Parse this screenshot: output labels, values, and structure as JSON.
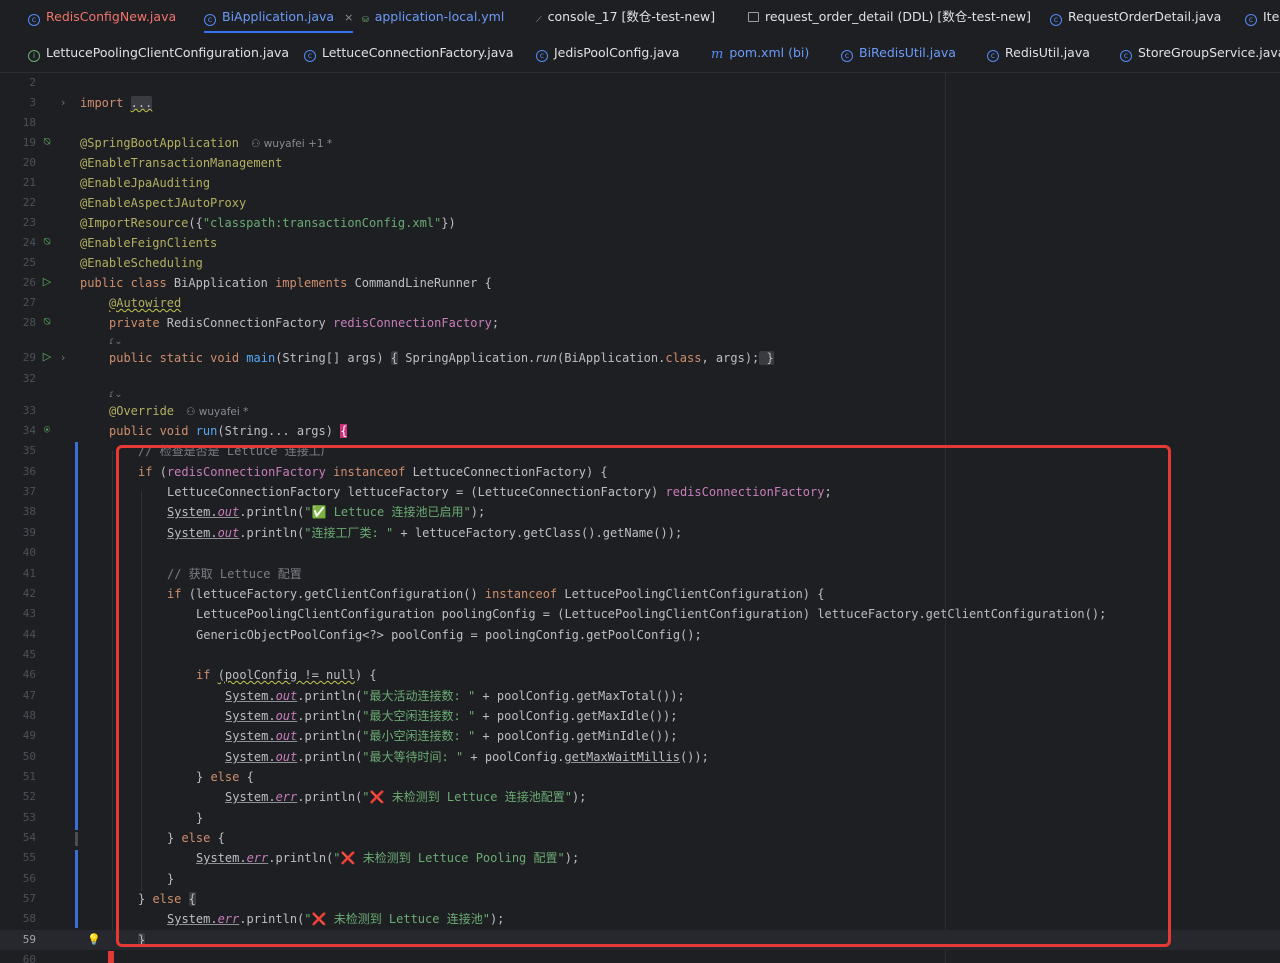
{
  "tabs_row1": [
    {
      "label": "RedisConfigNew.java",
      "icon": "class-icon",
      "style": "red"
    },
    {
      "label": "BiApplication.java",
      "icon": "class-icon",
      "style": "blue",
      "active": true,
      "close": "×"
    },
    {
      "label": "application-local.yml",
      "icon": "yml-icon",
      "style": "blue"
    },
    {
      "label": "console_17 [数仓-test-new]",
      "icon": "console-icon",
      "style": "normal"
    },
    {
      "label": "request_order_detail (DDL) [数仓-test-new]",
      "icon": "table-icon",
      "style": "normal"
    },
    {
      "label": "RequestOrderDetail.java",
      "icon": "class-icon",
      "style": "normal"
    },
    {
      "label": "Iter",
      "icon": "class-icon",
      "style": "normal"
    }
  ],
  "tabs_row2": [
    {
      "label": "LettucePoolingClientConfiguration.java",
      "icon": "interface-icon",
      "style": "normal"
    },
    {
      "label": "LettuceConnectionFactory.java",
      "icon": "class-icon",
      "style": "normal"
    },
    {
      "label": "JedisPoolConfig.java",
      "icon": "class-icon",
      "style": "normal"
    },
    {
      "label": "pom.xml (bi)",
      "icon": "maven-icon",
      "style": "blue"
    },
    {
      "label": "BiRedisUtil.java",
      "icon": "class-icon",
      "style": "blue"
    },
    {
      "label": "RedisUtil.java",
      "icon": "class-icon",
      "style": "normal"
    },
    {
      "label": "StoreGroupService.java",
      "icon": "class-icon",
      "style": "normal"
    }
  ],
  "editor": {
    "line_numbers": [
      "2",
      "3",
      "18",
      "19",
      "20",
      "21",
      "22",
      "23",
      "24",
      "25",
      "26",
      "27",
      "28",
      "29",
      "32",
      "33",
      "34",
      "35",
      "36",
      "37",
      "38",
      "39",
      "40",
      "41",
      "42",
      "43",
      "44",
      "45",
      "46",
      "47",
      "48",
      "49",
      "50",
      "51",
      "52",
      "53",
      "54",
      "55",
      "56",
      "57",
      "58",
      "59",
      "60"
    ],
    "authors": {
      "line19": "wuyafei +1 *",
      "line33": "wuyafei *"
    },
    "code": {
      "l3_kw": "import",
      "l3_rest": "...",
      "l19": "@SpringBootApplication",
      "l20": "@EnableTransactionManagement",
      "l21": "@EnableJpaAuditing",
      "l22": "@EnableAspectJAutoProxy",
      "l23_a": "@ImportResource",
      "l23_b": "({",
      "l23_c": "\"classpath:transactionConfig.xml\"",
      "l23_d": "})",
      "l24": "@EnableFeignClients",
      "l25": "@EnableScheduling",
      "l26_a": "public class ",
      "l26_b": "BiApplication ",
      "l26_c": "implements ",
      "l26_d": "CommandLineRunner {",
      "l27": "@Autowired",
      "l28_a": "private ",
      "l28_b": "RedisConnectionFactory ",
      "l28_c": "redisConnectionFactory",
      "l28_d": ";",
      "l29_a": "public static void ",
      "l29_b": "main",
      "l29_c": "(String[] args) ",
      "l29_d": "{",
      "l29_e": " SpringApplication.",
      "l29_f": "run",
      "l29_g": "(BiApplication.",
      "l29_h": "class",
      "l29_i": ", args);",
      "l29_j": " }",
      "l33": "@Override",
      "l34_a": "public void ",
      "l34_b": "run",
      "l34_c": "(String... args) ",
      "l34_d": "{",
      "l35": "// 检查是否是 Lettuce 连接工厂",
      "l36_a": "if ",
      "l36_b": "(",
      "l36_c": "redisConnectionFactory ",
      "l36_d": "instanceof ",
      "l36_e": "LettuceConnectionFactory) {",
      "l37_a": "LettuceConnectionFactory lettuceFactory = (LettuceConnectionFactory) ",
      "l37_b": "redisConnectionFactory",
      "l37_c": ";",
      "l38_a": "System.",
      "l38_b": "out",
      "l38_c": ".println(",
      "l38_d": "\"✅ Lettuce 连接池已启用\"",
      "l38_e": ");",
      "l39_a": "System.",
      "l39_b": "out",
      "l39_c": ".println(",
      "l39_d": "\"连接工厂类: \"",
      "l39_e": " + lettuceFactory.getClass().getName());",
      "l41": "// 获取 Lettuce 配置",
      "l42_a": "if ",
      "l42_b": "(lettuceFactory.getClientConfiguration() ",
      "l42_c": "instanceof ",
      "l42_d": "LettucePoolingClientConfiguration) {",
      "l43": "LettucePoolingClientConfiguration poolingConfig = (LettucePoolingClientConfiguration) lettuceFactory.getClientConfiguration();",
      "l44": "GenericObjectPoolConfig<?> poolConfig = poolingConfig.getPoolConfig();",
      "l46_a": "if ",
      "l46_b": "(poolConfig != null",
      "l46_c": ") {",
      "l47_d": "\"最大活动连接数: \"",
      "l47_e": " + poolConfig.getMaxTotal());",
      "l48_d": "\"最大空闲连接数: \"",
      "l48_e": " + poolConfig.getMaxIdle());",
      "l49_d": "\"最小空闲连接数: \"",
      "l49_e": " + poolConfig.getMinIdle());",
      "l50_d": "\"最大等待时间: \"",
      "l50_e1": " + poolConfig.",
      "l50_e2": "getMaxWaitMillis",
      "l50_e3": "());",
      "l51_a": "} ",
      "l51_b": "else ",
      "l51_c": "{",
      "l52_a": "System.",
      "l52_b": "err",
      "l52_c": ".println(",
      "l52_d": "\"❌ 未检测到 Lettuce 连接池配置\"",
      "l52_e": ");",
      "close": "}",
      "l55_d": "\"❌ 未检测到 Lettuce Pooling 配置\"",
      "l58_d": "\"❌ 未检测到 Lettuce 连接池\"",
      "l59": "}"
    },
    "inlay_hint": "ɾ⌄"
  },
  "colors": {
    "highlight_box": "#e53935",
    "keyword": "#cf8e6d",
    "annotation": "#b3ae60",
    "string": "#6aab73",
    "field": "#c77dbb",
    "method": "#56a8f5"
  }
}
